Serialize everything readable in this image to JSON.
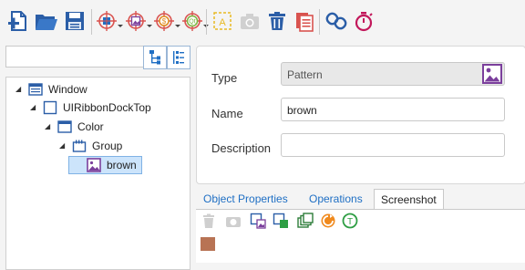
{
  "toolbar": {
    "icons": [
      "new-file-icon",
      "open-folder-icon",
      "save-icon",
      "windows-target-icon",
      "image-target-icon",
      "java-target-icon",
      "qt-target-icon",
      "text-capture-icon",
      "camera-icon",
      "delete-icon",
      "clipboard-icon",
      "link-icon",
      "timer-icon"
    ],
    "accent": "#1f6fc4"
  },
  "search": {
    "placeholder": ""
  },
  "tree": {
    "items": [
      {
        "label": "Window",
        "icon": "window-icon",
        "expanded": true
      },
      {
        "label": "UIRibbonDockTop",
        "icon": "panel-icon",
        "expanded": true
      },
      {
        "label": "Color",
        "icon": "window-icon",
        "expanded": true
      },
      {
        "label": "Group",
        "icon": "group-icon",
        "expanded": true
      },
      {
        "label": "brown",
        "icon": "pattern-image-icon",
        "selected": true
      }
    ]
  },
  "properties": {
    "type_label": "Type",
    "type_value": "Pattern",
    "name_label": "Name",
    "name_value": "brown",
    "description_label": "Description",
    "description_value": ""
  },
  "tabs": [
    {
      "label": "Object Properties"
    },
    {
      "label": "Operations"
    },
    {
      "label": "Screenshot",
      "active": true
    }
  ],
  "screenshot": {
    "icons": [
      "delete-icon",
      "camera-icon",
      "crop-image-icon",
      "crop-region-icon",
      "layers-icon",
      "refresh-icon",
      "text-recognize-icon"
    ],
    "swatch_color": "#b87354"
  }
}
